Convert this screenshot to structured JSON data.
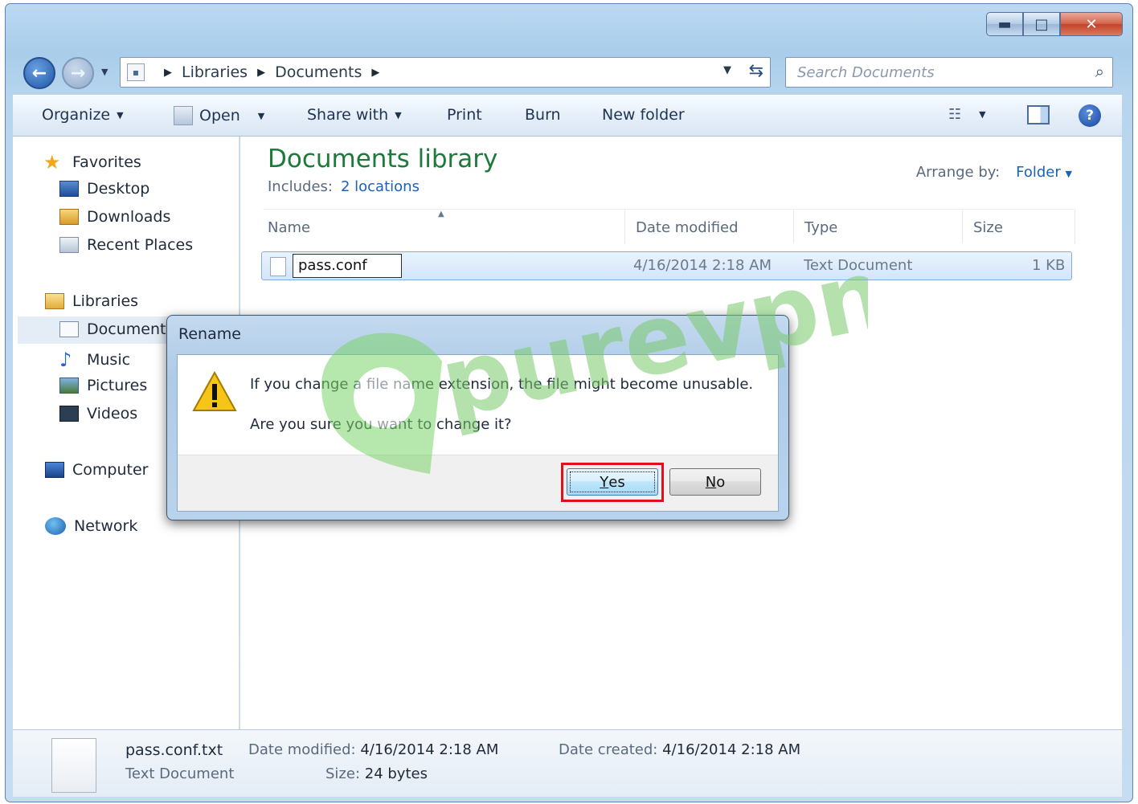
{
  "window": {
    "caption_buttons": {
      "minimize": "▬",
      "maximize": "□",
      "close": "✕"
    }
  },
  "address": {
    "crumbs": [
      "Libraries",
      "Documents"
    ],
    "search_placeholder": "Search Documents"
  },
  "toolbar": {
    "organize": "Organize",
    "open": "Open",
    "share_with": "Share with",
    "print": "Print",
    "burn": "Burn",
    "new_folder": "New folder"
  },
  "navpane": {
    "favorites": "Favorites",
    "desktop": "Desktop",
    "downloads": "Downloads",
    "recent_places": "Recent Places",
    "libraries": "Libraries",
    "documents": "Document",
    "music": "Music",
    "pictures": "Pictures",
    "videos": "Videos",
    "computer": "Computer",
    "network": "Network"
  },
  "content": {
    "title": "Documents library",
    "includes_label": "Includes:",
    "includes_link": "2 locations",
    "arrange_label": "Arrange by:",
    "arrange_value": "Folder",
    "columns": {
      "name": "Name",
      "date": "Date modified",
      "type": "Type",
      "size": "Size"
    },
    "file": {
      "rename_value": "pass.conf",
      "date": "4/16/2014 2:18 AM",
      "type": "Text Document",
      "size": "1 KB"
    }
  },
  "details": {
    "name": "pass.conf.txt",
    "type": "Text Document",
    "date_modified_label": "Date modified:",
    "date_modified": "4/16/2014 2:18 AM",
    "size_label": "Size:",
    "size": "24 bytes",
    "date_created_label": "Date created:",
    "date_created": "4/16/2014 2:18 AM"
  },
  "dialog": {
    "title": "Rename",
    "message1": "If you change a file name extension, the file might become unusable.",
    "message2": "Are you sure you want to change it?",
    "yes_label_first": "Y",
    "yes_label_rest": "es",
    "no_label_first": "N",
    "no_label_rest": "o"
  },
  "watermark": {
    "text": "purevpn"
  },
  "colors": {
    "accent_green": "#1d7a3a",
    "link_blue": "#1a63b8",
    "highlight_red": "#e0101c"
  }
}
